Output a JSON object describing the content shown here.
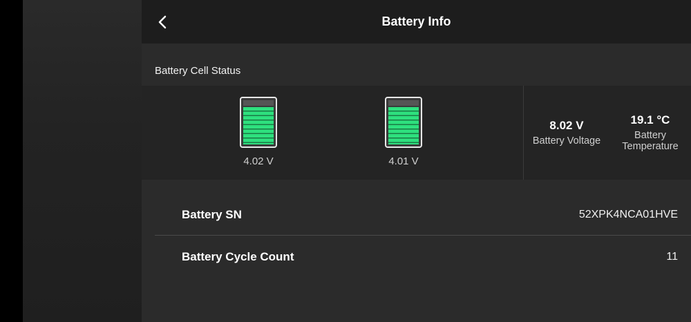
{
  "header": {
    "title": "Battery Info"
  },
  "cell_status": {
    "label": "Battery Cell Status",
    "cells": [
      {
        "voltage": "4.02 V",
        "level": 1.0
      },
      {
        "voltage": "4.01 V",
        "level": 1.0
      }
    ],
    "battery_voltage": {
      "value": "8.02 V",
      "label": "Battery Voltage"
    },
    "battery_temperature": {
      "value": "19.1 °C",
      "label_line1": "Battery",
      "label_line2": "Temperature"
    }
  },
  "rows": [
    {
      "label": "Battery SN",
      "value": "52XPK4NCA01HVE"
    },
    {
      "label": "Battery Cycle Count",
      "value": "11"
    }
  ],
  "colors": {
    "cell_fill": "#2ee07e",
    "header_bg": "#1d1d1d",
    "panel_bg": "#242424"
  }
}
